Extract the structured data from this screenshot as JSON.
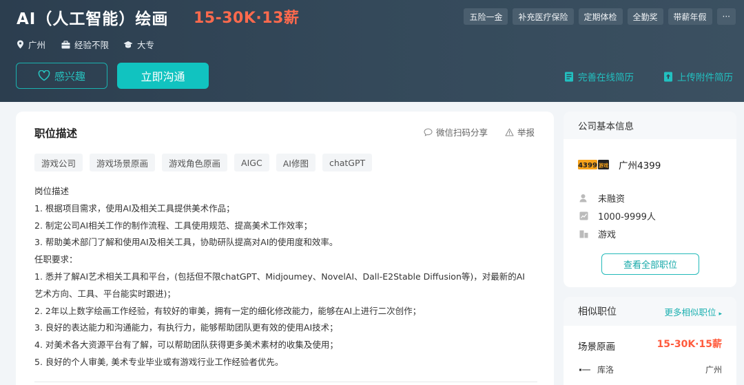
{
  "header": {
    "title": "AI（人工智能）绘画",
    "salary": "15-30K·13薪",
    "location": "广州",
    "experience": "经验不限",
    "education": "大专",
    "benefits": [
      "五险一金",
      "补充医疗保险",
      "定期体检",
      "全勤奖",
      "带薪年假",
      "···"
    ],
    "interest_label": "感兴趣",
    "chat_label": "立即沟通",
    "online_resume_label": "完善在线简历",
    "attach_resume_label": "上传附件简历"
  },
  "job": {
    "section_title": "职位描述",
    "share_label": "微信扫码分享",
    "report_label": "举报",
    "tags": [
      "游戏公司",
      "游戏场景原画",
      "游戏角色原画",
      "AIGC",
      "AI修图",
      "chatGPT"
    ],
    "description_lines": [
      "岗位描述",
      "1. 根据项目需求，使用AI及相关工具提供美术作品；",
      "2. 制定公司AI相关工作的制作流程、工具使用规范、提高美术工作效率；",
      "3. 帮助美术部门了解和使用AI及相关工具，协助研队提高对AI的使用度和效率。",
      "任职要求：",
      "1. 悉并了解AI艺术相关工具和平台，(包括但不限chatGPT、Midjoumey、NovelAI、Dall-E2Stable Diffusion等)，对最新的AI",
      "艺术方向、工具、平台能实时跟进)；",
      "2. 2年以上数字绘画工作经验，有较好的审美，拥有一定的细化修改能力，能够在AI上进行二次创作；",
      "3. 良好的表达能力和沟通能力，有执行力，能够帮助团队更有效的使用AI技术；",
      "4. 对美术各大资源平台有了解，可以帮助团队获得更多美术素材的收集及使用；",
      "5. 良好的个人审美, 美术专业毕业或有游戏行业工作经验者优先。"
    ]
  },
  "company": {
    "section_title": "公司基本信息",
    "logo_text": "4399游戏",
    "name": "广州4399",
    "funding": "未融资",
    "size": "1000-9999人",
    "industry": "游戏",
    "view_all_label": "查看全部职位"
  },
  "similar": {
    "section_title": "相似职位",
    "more_label": "更多相似职位",
    "job_title": "场景原画",
    "job_salary": "15-30K·15薪",
    "company": "库洛",
    "city": "广州"
  },
  "colors": {
    "accent": "#11c3c0",
    "salary": "#ff6a4d",
    "banner": "#34495a"
  }
}
